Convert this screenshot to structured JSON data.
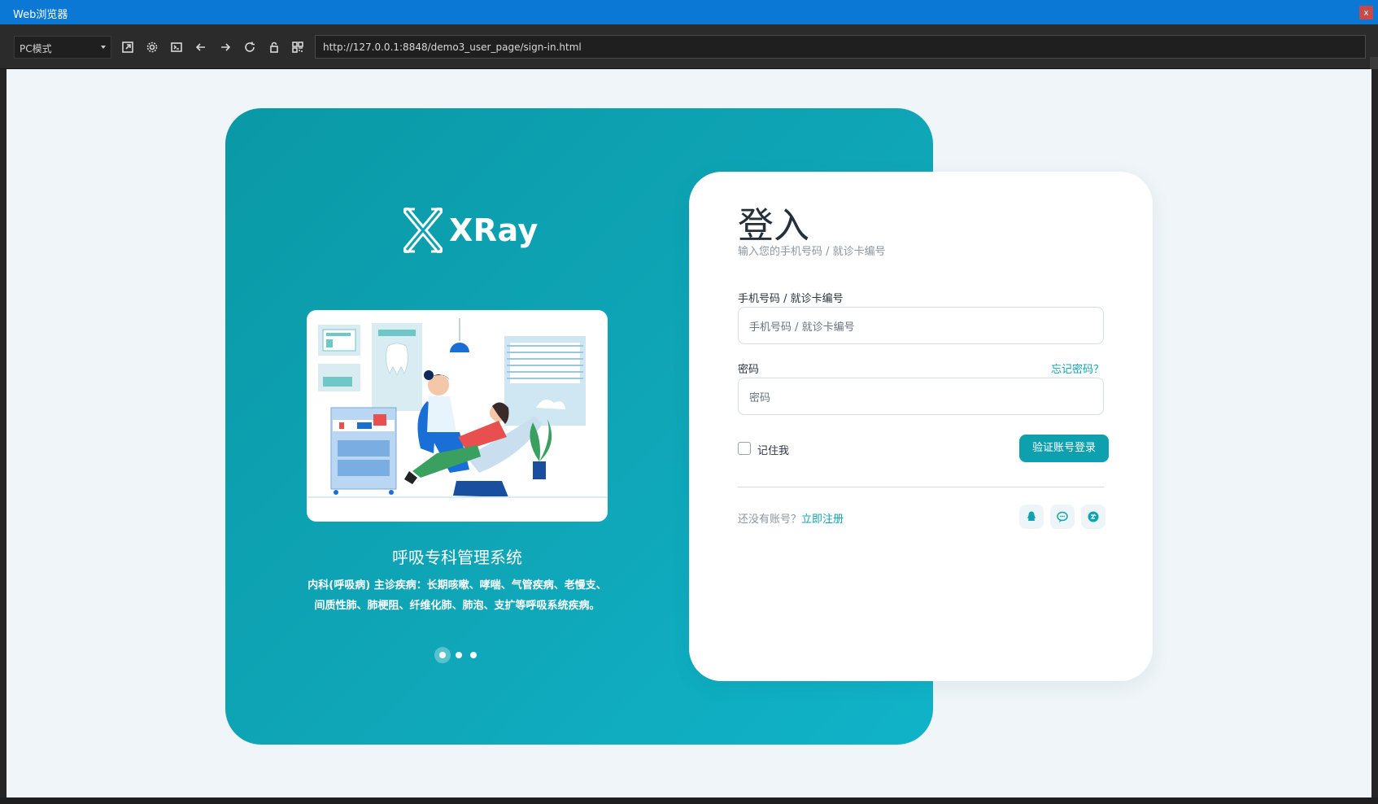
{
  "window": {
    "title": "Web浏览器",
    "close_label": "x"
  },
  "toolbar": {
    "mode": "PC模式",
    "url": "http://127.0.0.1:8848/demo3_user_page/sign-in.html"
  },
  "brand": {
    "name": "XRay"
  },
  "carousel": {
    "title": "呼吸专科管理系统",
    "description": "内科(呼吸病) 主诊疾病：长期咳嗽、哮喘、气管疾病、老慢支、间质性肺、肺梗阻、纤维化肺、肺泡、支扩等呼吸系统疾病。",
    "active_index": 0,
    "count": 3
  },
  "login": {
    "title": "登入",
    "subtitle": "输入您的手机号码 / 就诊卡编号",
    "account_label": "手机号码 / 就诊卡编号",
    "account_placeholder": "手机号码 / 就诊卡编号",
    "password_label": "密码",
    "forgot_label": "忘记密码？",
    "password_placeholder": "密码",
    "remember_label": "记住我",
    "submit_label": "验证账号登录",
    "no_account_text": "还没有账号？",
    "register_label": "立即注册",
    "social": [
      "qq-icon",
      "wechat-icon",
      "weibo-icon"
    ]
  },
  "colors": {
    "accent": "#0fa3b1",
    "titlebar": "#0a78d4"
  }
}
